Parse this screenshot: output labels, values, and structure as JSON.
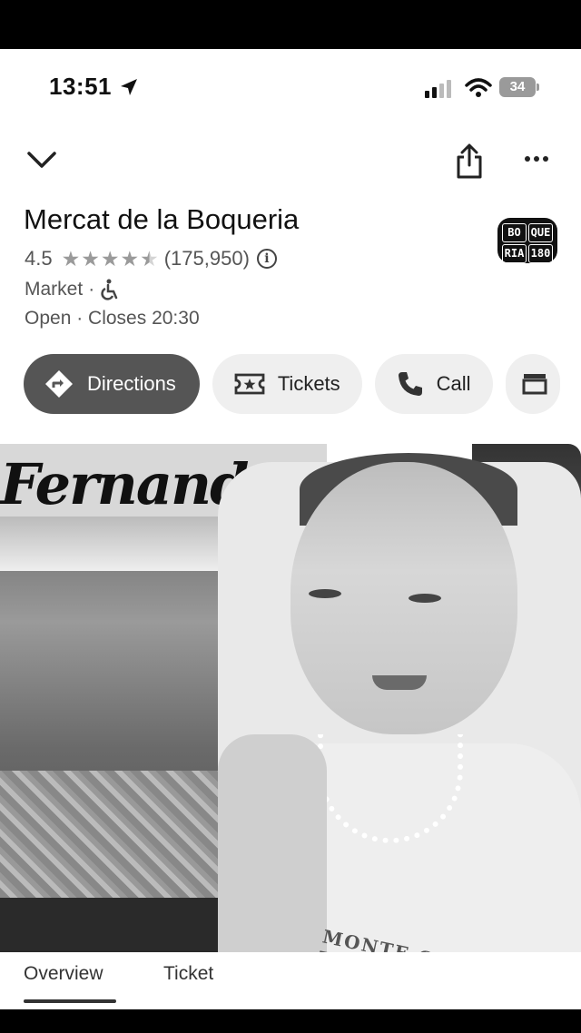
{
  "status_bar": {
    "time": "13:51",
    "battery": "34"
  },
  "header": {
    "collapse_icon": "chevron-down-icon",
    "share_icon": "share-icon",
    "more_icon": "more-dots-icon"
  },
  "place": {
    "name": "Mercat de la Boqueria",
    "rating": "4.5",
    "star_count": 4.5,
    "reviews": "(175,950)",
    "category": "Market",
    "separator": "·",
    "status": "Open",
    "closes": "Closes 20:30",
    "logo_text": [
      "BO",
      "QUE",
      "RIA",
      "180"
    ]
  },
  "actions": [
    {
      "label": "Directions",
      "icon": "directions-icon"
    },
    {
      "label": "Tickets",
      "icon": "ticket-icon"
    },
    {
      "label": "Call",
      "icon": "phone-icon"
    },
    {
      "label": "",
      "icon": "store-icon"
    }
  ],
  "photos": {
    "market_sign": "Fernand",
    "shirt_text": "MONTE CARLO TENNIS"
  },
  "tabs": [
    {
      "label": "Overview",
      "active": true
    },
    {
      "label": "Ticket",
      "active": false
    }
  ]
}
